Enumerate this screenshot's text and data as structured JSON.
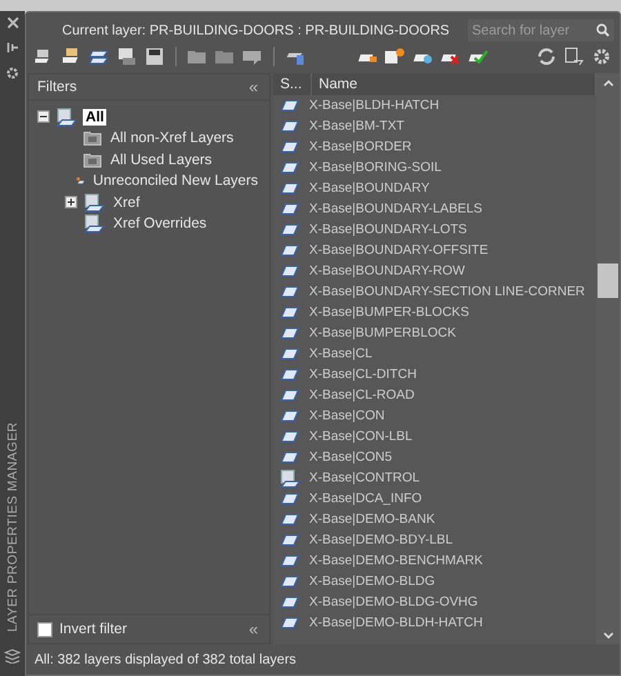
{
  "side_strip": {
    "title": "LAYER PROPERTIES MANAGER"
  },
  "header": {
    "current_layer": "Current layer: PR-BUILDING-DOORS : PR-BUILDING-DOORS",
    "search": {
      "placeholder": "Search for layer"
    }
  },
  "filters": {
    "title": "Filters",
    "collapse": "«",
    "tree": [
      {
        "label": "All",
        "kind": "all",
        "selected": true,
        "expanded": true,
        "children": [
          {
            "label": "All non-Xref Layers",
            "kind": "filter",
            "selected": false
          },
          {
            "label": "All Used Layers",
            "kind": "filter",
            "selected": false
          },
          {
            "label": "Unreconciled New Layers",
            "kind": "unreconciled",
            "selected": false
          },
          {
            "label": "Xref",
            "kind": "xref",
            "selected": false,
            "expanded": false
          },
          {
            "label": "Xref Overrides",
            "kind": "xref",
            "selected": false
          }
        ]
      }
    ],
    "invert_filter": {
      "label": "Invert filter",
      "checked": false
    },
    "bottom_collapse": "«"
  },
  "layers": {
    "columns": [
      "S...",
      "Name"
    ],
    "rows": [
      {
        "name": "X-Base|BLDH-HATCH",
        "kind": "layer"
      },
      {
        "name": "X-Base|BM-TXT",
        "kind": "layer"
      },
      {
        "name": "X-Base|BORDER",
        "kind": "layer"
      },
      {
        "name": "X-Base|BORING-SOIL",
        "kind": "layer"
      },
      {
        "name": "X-Base|BOUNDARY",
        "kind": "layer"
      },
      {
        "name": "X-Base|BOUNDARY-LABELS",
        "kind": "layer"
      },
      {
        "name": "X-Base|BOUNDARY-LOTS",
        "kind": "layer"
      },
      {
        "name": "X-Base|BOUNDARY-OFFSITE",
        "kind": "layer"
      },
      {
        "name": "X-Base|BOUNDARY-ROW",
        "kind": "layer"
      },
      {
        "name": "X-Base|BOUNDARY-SECTION LINE-CORNER",
        "kind": "layer"
      },
      {
        "name": "X-Base|BUMPER-BLOCKS",
        "kind": "layer"
      },
      {
        "name": "X-Base|BUMPERBLOCK",
        "kind": "layer"
      },
      {
        "name": "X-Base|CL",
        "kind": "layer"
      },
      {
        "name": "X-Base|CL-DITCH",
        "kind": "layer"
      },
      {
        "name": "X-Base|CL-ROAD",
        "kind": "layer"
      },
      {
        "name": "X-Base|CON",
        "kind": "layer"
      },
      {
        "name": "X-Base|CON-LBL",
        "kind": "layer"
      },
      {
        "name": "X-Base|CON5",
        "kind": "layer"
      },
      {
        "name": "X-Base|CONTROL",
        "kind": "xref_layer"
      },
      {
        "name": "X-Base|DCA_INFO",
        "kind": "layer"
      },
      {
        "name": "X-Base|DEMO-BANK",
        "kind": "layer"
      },
      {
        "name": "X-Base|DEMO-BDY-LBL",
        "kind": "layer"
      },
      {
        "name": "X-Base|DEMO-BENCHMARK",
        "kind": "layer"
      },
      {
        "name": "X-Base|DEMO-BLDG",
        "kind": "layer"
      },
      {
        "name": "X-Base|DEMO-BLDG-OVHG",
        "kind": "layer"
      },
      {
        "name": "X-Base|DEMO-BLDH-HATCH",
        "kind": "layer"
      }
    ]
  },
  "status_bar": "All: 382 layers displayed of 382 total layers"
}
